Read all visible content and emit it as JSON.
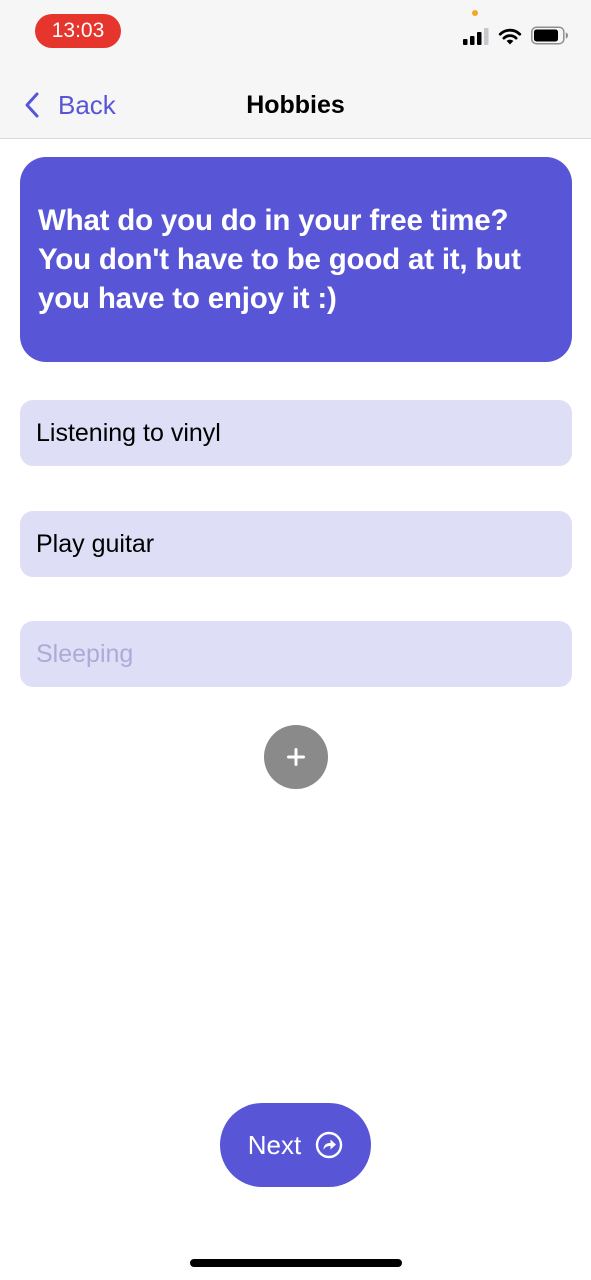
{
  "status_bar": {
    "time": "13:03"
  },
  "nav": {
    "back_label": "Back",
    "title": "Hobbies"
  },
  "question": {
    "text": "What do you do in your free time? You don't have to be good at it, but you have to enjoy it :)"
  },
  "hobbies": [
    {
      "value": "Listening to vinyl",
      "placeholder": ""
    },
    {
      "value": "Play guitar",
      "placeholder": ""
    },
    {
      "value": "",
      "placeholder": "Sleeping"
    }
  ],
  "add_button": {
    "icon": "plus-icon"
  },
  "next_button": {
    "label": "Next",
    "icon": "arrow-forward-circle-icon"
  },
  "colors": {
    "accent": "#5856d6",
    "field_background": "#dedef7",
    "time_pill": "#e5352c",
    "add_button": "#8a8a8a"
  }
}
